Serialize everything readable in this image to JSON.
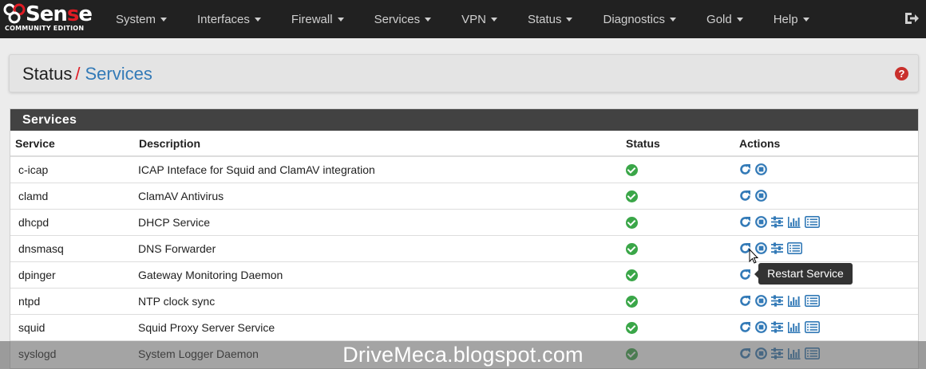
{
  "brand": {
    "name_prefix": "Sen",
    "name_accent": "s",
    "name_suffix": "e",
    "edition": "COMMUNITY EDITION"
  },
  "nav": {
    "items": [
      {
        "label": "System"
      },
      {
        "label": "Interfaces"
      },
      {
        "label": "Firewall"
      },
      {
        "label": "Services"
      },
      {
        "label": "VPN"
      },
      {
        "label": "Status"
      },
      {
        "label": "Diagnostics"
      },
      {
        "label": "Gold"
      },
      {
        "label": "Help"
      }
    ],
    "logout_icon": "sign-out-icon"
  },
  "breadcrumb": {
    "root": "Status",
    "separator": "/",
    "current": "Services"
  },
  "panel": {
    "title": "Services",
    "columns": {
      "service": "Service",
      "description": "Description",
      "status": "Status",
      "actions": "Actions"
    },
    "rows": [
      {
        "service": "c-icap",
        "description": "ICAP Inteface for Squid and ClamAV integration",
        "status": "running",
        "actions": [
          "restart",
          "stop"
        ]
      },
      {
        "service": "clamd",
        "description": "ClamAV Antivirus",
        "status": "running",
        "actions": [
          "restart",
          "stop"
        ]
      },
      {
        "service": "dhcpd",
        "description": "DHCP Service",
        "status": "running",
        "actions": [
          "restart",
          "stop",
          "settings",
          "graph",
          "log"
        ]
      },
      {
        "service": "dnsmasq",
        "description": "DNS Forwarder",
        "status": "running",
        "actions": [
          "restart",
          "stop",
          "settings",
          "log"
        ]
      },
      {
        "service": "dpinger",
        "description": "Gateway Monitoring Daemon",
        "status": "running",
        "actions": [
          "restart"
        ]
      },
      {
        "service": "ntpd",
        "description": "NTP clock sync",
        "status": "running",
        "actions": [
          "restart",
          "stop",
          "settings",
          "graph",
          "log"
        ]
      },
      {
        "service": "squid",
        "description": "Squid Proxy Server Service",
        "status": "running",
        "actions": [
          "restart",
          "stop",
          "settings",
          "graph",
          "log"
        ]
      },
      {
        "service": "syslogd",
        "description": "System Logger Daemon",
        "status": "running",
        "actions": [
          "restart",
          "stop",
          "settings",
          "graph",
          "log"
        ]
      }
    ]
  },
  "tooltip": {
    "text": "Restart Service"
  },
  "watermark": "DriveMeca.blogspot.com",
  "colors": {
    "navbar": "#212121",
    "accent_red": "#e01b24",
    "link_blue": "#337ab7",
    "status_green": "#3aa648",
    "panel_head": "#424242"
  }
}
